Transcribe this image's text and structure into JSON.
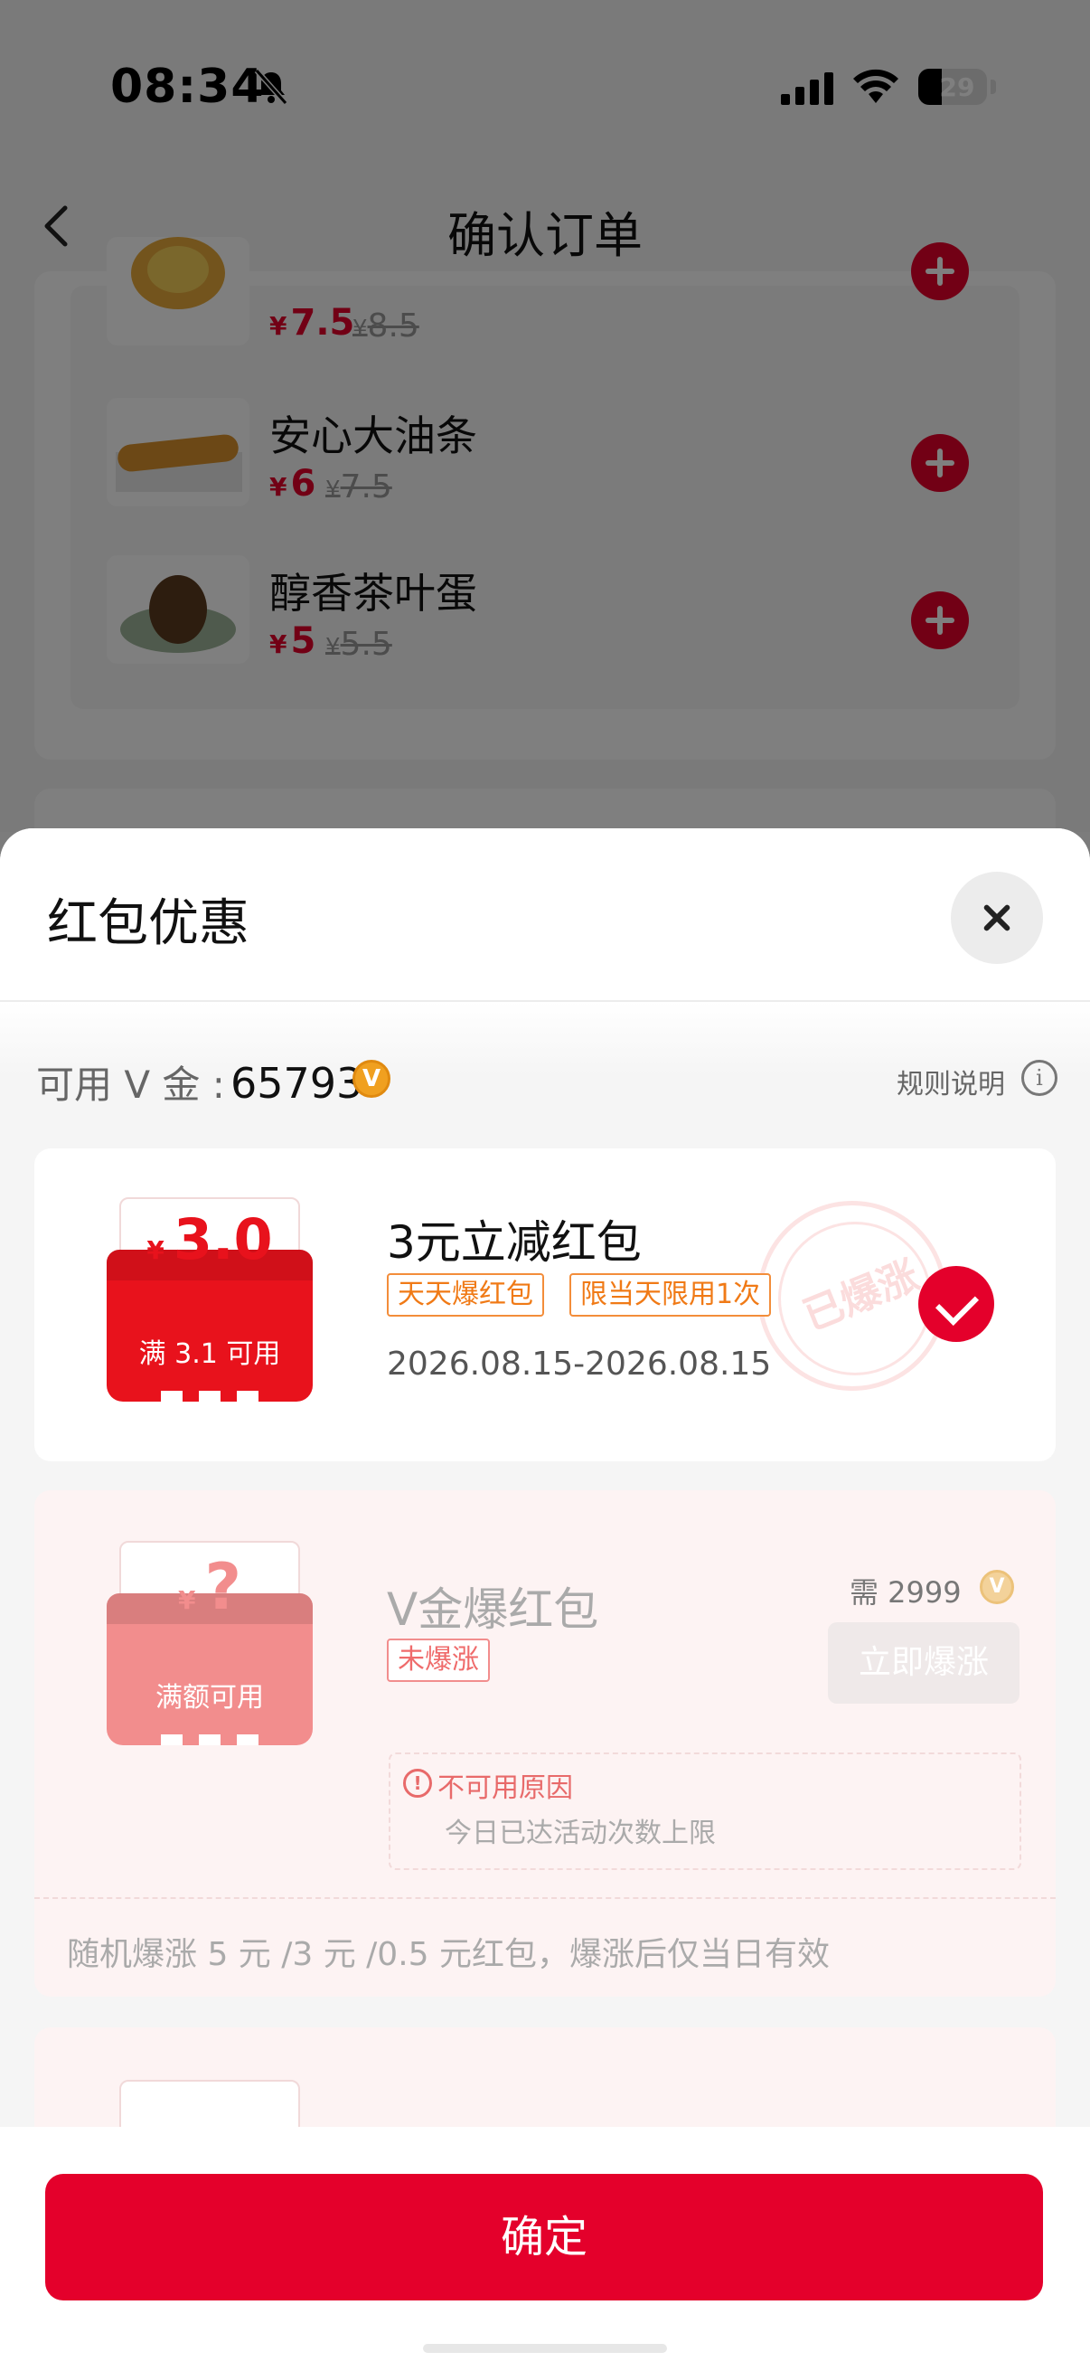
{
  "status_bar": {
    "time": "08:34",
    "battery": "29"
  },
  "nav": {
    "title": "确认订单"
  },
  "menu_items": [
    {
      "name": "",
      "price": "7.5",
      "original_price": "8.5",
      "currency": "¥"
    },
    {
      "name": "安心大油条",
      "price": "6",
      "original_price": "7.5",
      "currency": "¥"
    },
    {
      "name": "醇香茶叶蛋",
      "price": "5",
      "original_price": "5.5",
      "currency": "¥"
    }
  ],
  "sheet": {
    "title": "红包优惠",
    "vgold_label": "可用 V 金 :",
    "vgold_amount": "65793",
    "v_icon": "V",
    "rules_label": "规则说明",
    "coupons": [
      {
        "currency": "¥",
        "amount": "3.0",
        "condition": "满 3.1 可用",
        "title": "3元立减红包",
        "tags": [
          "天天爆红包",
          "限当天限用1次"
        ],
        "dates": "2026.08.15-2026.08.15",
        "stamp": "已爆涨",
        "selected": true
      },
      {
        "currency": "¥",
        "amount": "?",
        "condition": "满额可用",
        "title": "V金爆红包",
        "tags": [
          "未爆涨"
        ],
        "need_label": "需 2999",
        "button": "立即爆涨",
        "reason_title": "不可用原因",
        "reason_text": "今日已达活动次数上限",
        "description": "随机爆涨 5 元 /3 元 /0.5 元红包，爆涨后仅当日有效"
      }
    ]
  },
  "footer": {
    "confirm_label": "确定"
  },
  "colors": {
    "accent": "#e4002b",
    "tag_orange": "#f07a16",
    "gold": "#f0a020"
  }
}
